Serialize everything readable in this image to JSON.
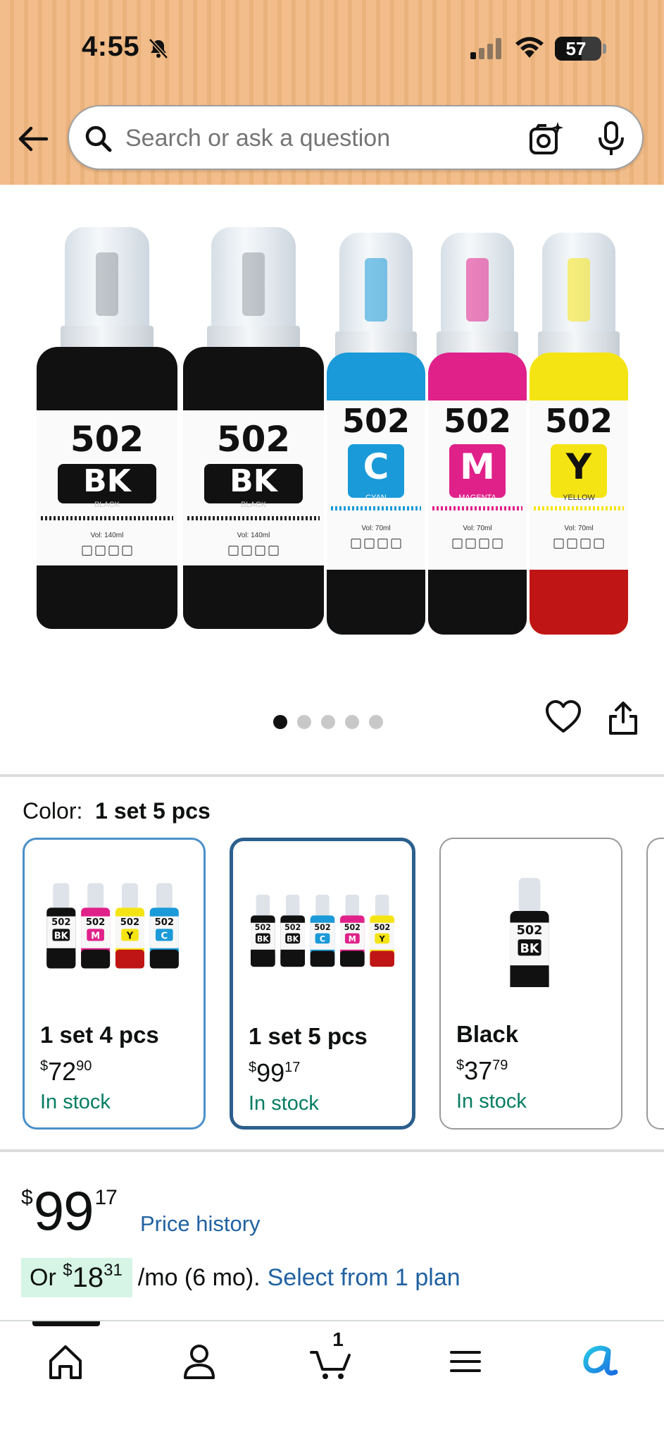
{
  "status_bar": {
    "time": "4:55",
    "battery": "57",
    "battery_level": 0.57
  },
  "search": {
    "placeholder": "Search or ask a question"
  },
  "gallery": {
    "image_count": 5,
    "active_index": 0,
    "bottles": [
      {
        "number": "502",
        "code": "BK",
        "name": "BLACK",
        "volume": "Vol: 140ml",
        "color": "#111111"
      },
      {
        "number": "502",
        "code": "BK",
        "name": "BLACK",
        "volume": "Vol: 140ml",
        "color": "#111111"
      },
      {
        "number": "502",
        "code": "C",
        "name": "CYAN",
        "volume": "Vol: 70ml",
        "color": "#1a9ad8"
      },
      {
        "number": "502",
        "code": "M",
        "name": "MAGENTA",
        "volume": "Vol: 70ml",
        "color": "#e0218a"
      },
      {
        "number": "502",
        "code": "Y",
        "name": "YELLOW",
        "volume": "Vol: 70ml",
        "color": "#f5e414"
      }
    ]
  },
  "color_selector": {
    "label": "Color:",
    "selected": "1 set 5 pcs",
    "options": [
      {
        "title": "1 set 4 pcs",
        "currency": "$",
        "whole": "72",
        "cents": "90",
        "stock": "In stock"
      },
      {
        "title": "1 set 5 pcs",
        "currency": "$",
        "whole": "99",
        "cents": "17",
        "stock": "In stock"
      },
      {
        "title": "Black",
        "currency": "$",
        "whole": "37",
        "cents": "79",
        "stock": "In stock"
      }
    ]
  },
  "price": {
    "currency": "$",
    "whole": "99",
    "cents": "17",
    "history_link": "Price history"
  },
  "installment": {
    "prefix": "Or",
    "currency": "$",
    "whole": "18",
    "cents": "31",
    "term": "/mo (6 mo).",
    "link": "Select from 1 plan"
  },
  "bottom_nav": {
    "cart_count": "1",
    "items": [
      "home-icon",
      "account-icon",
      "cart-icon",
      "menu-icon",
      "rufus-icon"
    ]
  },
  "colors": {
    "link": "#2162a1",
    "stock": "#067d62",
    "selected_border": "#2c5f8c",
    "card_border": "#4a90c8",
    "installment_bg": "#d6f5e6",
    "rufus_blue": "#1a8fe0"
  }
}
